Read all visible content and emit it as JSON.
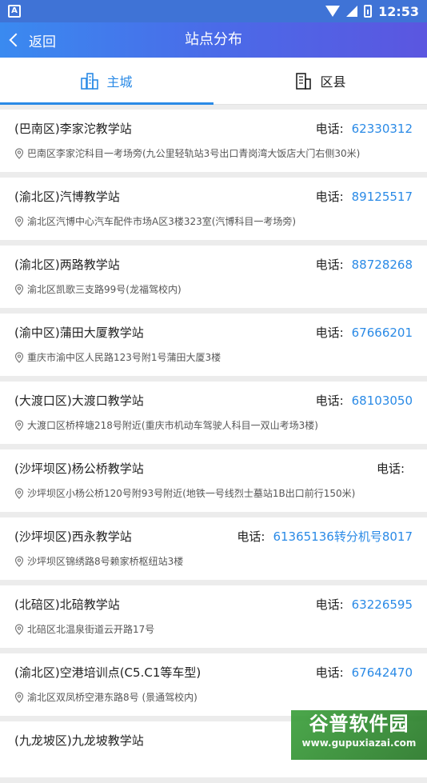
{
  "status": {
    "time": "12:53",
    "left_icon": "A"
  },
  "header": {
    "back_label": "返回",
    "title": "站点分布"
  },
  "tabs": [
    {
      "label": "主城",
      "icon": "city-buildings-icon",
      "active": true
    },
    {
      "label": "区县",
      "icon": "office-building-icon",
      "active": false
    }
  ],
  "stations": [
    {
      "name": "(巴南区)李家沱教学站",
      "phone_label": "电话:",
      "phone": "62330312",
      "address": "巴南区李家沱科目一考场旁(九公里轻轨站3号出口青岗湾大饭店大门右侧30米)"
    },
    {
      "name": "(渝北区)汽博教学站",
      "phone_label": "电话:",
      "phone": "89125517",
      "address": "渝北区汽博中心汽车配件市场A区3楼323室(汽博科目一考场旁)"
    },
    {
      "name": "(渝北区)两路教学站",
      "phone_label": "电话:",
      "phone": "88728268",
      "address": "渝北区凯歌三支路99号(龙福驾校内)"
    },
    {
      "name": "(渝中区)蒲田大厦教学站",
      "phone_label": "电话:",
      "phone": "67666201",
      "address": "重庆市渝中区人民路123号附1号蒲田大厦3楼"
    },
    {
      "name": "(大渡口区)大渡口教学站",
      "phone_label": "电话:",
      "phone": "68103050",
      "address": "大渡口区桥梓塘218号附近(重庆市机动车驾驶人科目一双山考场3楼)"
    },
    {
      "name": "(沙坪坝区)杨公桥教学站",
      "phone_label": "电话:",
      "phone": "",
      "address": "沙坪坝区小杨公桥120号附93号附近(地铁一号线烈士墓站1B出口前行150米)"
    },
    {
      "name": "(沙坪坝区)西永教学站",
      "phone_label": "电话:",
      "phone": "61365136转分机号8017",
      "address": "沙坪坝区锦绣路8号赖家桥枢纽站3楼"
    },
    {
      "name": "(北碚区)北碚教学站",
      "phone_label": "电话:",
      "phone": "63226595",
      "address": "北碚区北温泉街道云开路17号"
    },
    {
      "name": "(渝北区)空港培训点(C5.C1等车型)",
      "phone_label": "电话:",
      "phone": "67642470",
      "address": "渝北区双凤桥空港东路8号 (景通驾校内)"
    },
    {
      "name": "(九龙坡区)九龙坡教学站",
      "phone_label": "",
      "phone": "",
      "address": ""
    }
  ],
  "watermark": {
    "line1": "谷普软件园",
    "line2": "www.gupuxiazai.com"
  }
}
